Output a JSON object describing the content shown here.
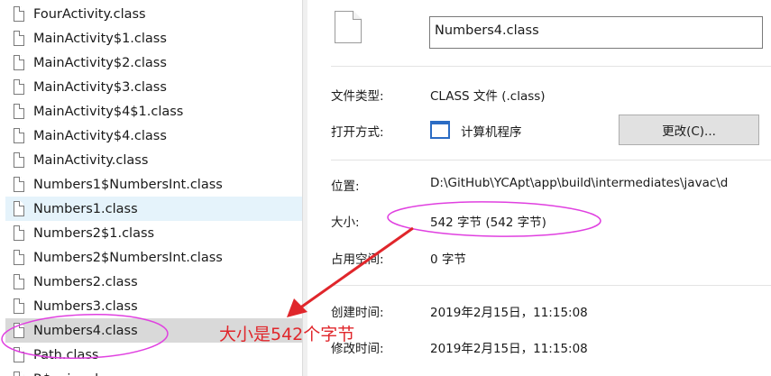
{
  "file_list": {
    "items": [
      {
        "name": "FourActivity.class",
        "state": "normal"
      },
      {
        "name": "MainActivity$1.class",
        "state": "normal"
      },
      {
        "name": "MainActivity$2.class",
        "state": "normal"
      },
      {
        "name": "MainActivity$3.class",
        "state": "normal"
      },
      {
        "name": "MainActivity$4$1.class",
        "state": "normal"
      },
      {
        "name": "MainActivity$4.class",
        "state": "normal"
      },
      {
        "name": "MainActivity.class",
        "state": "normal"
      },
      {
        "name": "Numbers1$NumbersInt.class",
        "state": "normal"
      },
      {
        "name": "Numbers1.class",
        "state": "hover"
      },
      {
        "name": "Numbers2$1.class",
        "state": "normal"
      },
      {
        "name": "Numbers2$NumbersInt.class",
        "state": "normal"
      },
      {
        "name": "Numbers2.class",
        "state": "normal"
      },
      {
        "name": "Numbers3.class",
        "state": "normal"
      },
      {
        "name": "Numbers4.class",
        "state": "selected"
      },
      {
        "name": "Path.class",
        "state": "normal"
      },
      {
        "name": "R$anim.cl",
        "state": "normal"
      }
    ]
  },
  "properties": {
    "file_name": "Numbers4.class",
    "type_label": "文件类型:",
    "type_value": "CLASS 文件 (.class)",
    "opens_with_label": "打开方式:",
    "opens_with_value": "计算机程序",
    "change_button": "更改(C)...",
    "location_label": "位置:",
    "location_value": "D:\\GitHub\\YCApt\\app\\build\\intermediates\\javac\\d",
    "size_label": "大小:",
    "size_value": "542 字节 (542 字节)",
    "size_on_disk_label": "占用空间:",
    "size_on_disk_value": "0 字节",
    "created_label": "创建时间:",
    "created_value": "2019年2月15日，11:15:08",
    "modified_label": "修改时间:",
    "modified_value": "2019年2月15日，11:15:08"
  },
  "annotation": {
    "text": "大小是542个字节",
    "color": "#e0262b",
    "circle_color": "#e040e0"
  },
  "colors": {
    "hover_row": "#e5f3fb",
    "selected_row": "#d9d9d9"
  }
}
